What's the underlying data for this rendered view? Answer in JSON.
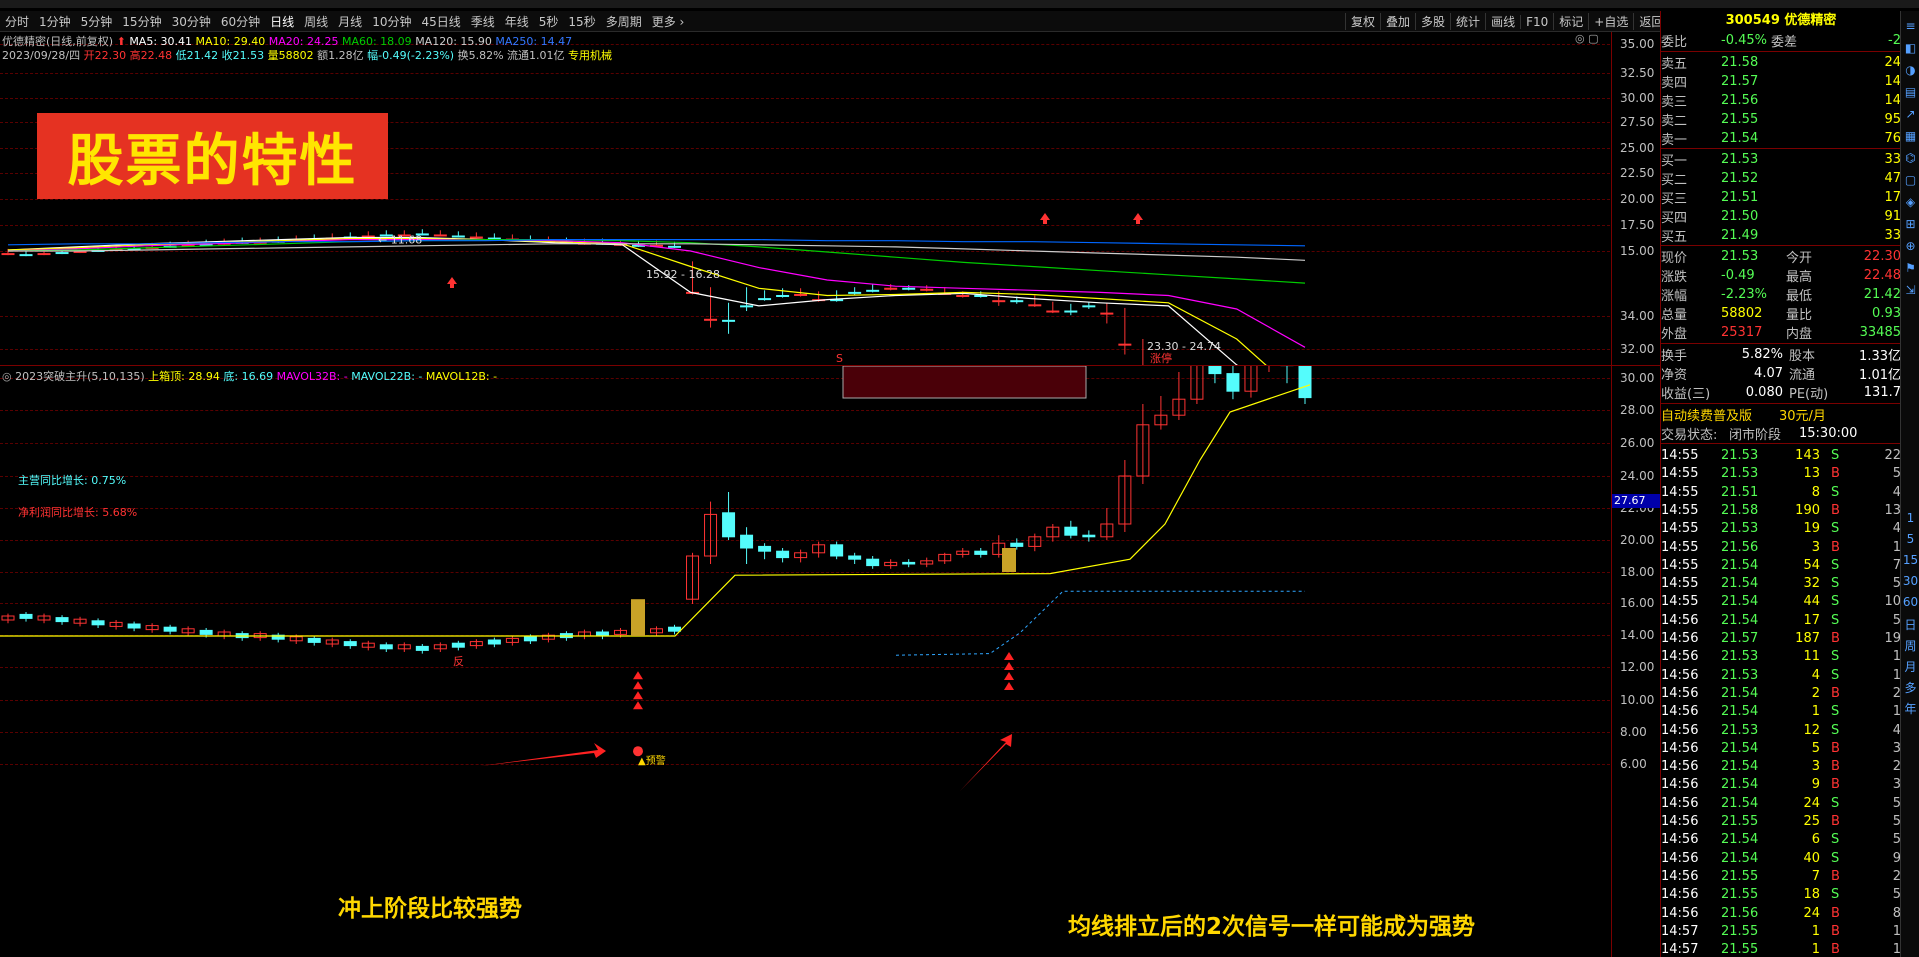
{
  "period_tabs": [
    "分时",
    "1分钟",
    "5分钟",
    "15分钟",
    "30分钟",
    "60分钟",
    "日线",
    "周线",
    "月线",
    "10分钟",
    "45日线",
    "季线",
    "年线",
    "5秒",
    "15秒",
    "多周期",
    "更多 ›"
  ],
  "toolbar": [
    "复权",
    "叠加",
    "多股",
    "统计",
    "画线",
    "F10",
    "标记",
    "+自选",
    "返回"
  ],
  "stock_header": "300549 优德精密",
  "main_info": {
    "name": "优德精密(日线,前复权)",
    "ma5": "MA5: 30.41",
    "ma10": "MA10: 29.40",
    "ma20": "MA20: 24.25",
    "ma60": "MA60: 18.09",
    "ma120": "MA120: 15.90",
    "ma250": "MA250: 14.47",
    "date": "2023/09/28/四",
    "open": "开22.30",
    "high": "高22.48",
    "low": "低21.42",
    "close": "收21.53",
    "vol": "量58802",
    "amount": "额1.28亿",
    "chg": "幅-0.49(-2.23%)",
    "turnover": "换5.82%",
    "float": "流通1.01亿",
    "sector": "专用机械"
  },
  "sub_info": {
    "name": "2023突破主升(5,10,135)",
    "upper": "上箱顶: 28.94",
    "bottom": "底: 16.69",
    "m32": "MAVOL32B: -",
    "m22": "MAVOL22B: -",
    "m12": "MAVOL12B: -"
  },
  "overlay_title": "股票的特性",
  "annotations": {
    "left": "冲上阶段比较强势",
    "right": "均线排立后的2次信号一样可能成为强势",
    "main_growth": "主营同比增长: 0.75%",
    "profit_growth": "净利润同比增长: 5.68%",
    "high_label": "34.00",
    "low_label": "11.68",
    "range1": "15.92 - 16.28",
    "range2": "23.30 - 24.74",
    "zhangting": "涨停",
    "alert": "▲预警",
    "s_marker": "S",
    "fan": "反",
    "price_tag": "27.67"
  },
  "y_main": [
    "35.00",
    "32.50",
    "30.00",
    "27.50",
    "25.00",
    "22.50",
    "20.00",
    "17.50",
    "15.00"
  ],
  "y_sub": [
    "34.00",
    "32.00",
    "30.00",
    "28.00",
    "26.00",
    "24.00",
    "22.00",
    "20.00",
    "18.00",
    "16.00",
    "14.00",
    "12.00",
    "10.00",
    "8.00",
    "6.00"
  ],
  "quote": {
    "weibi": {
      "label": "委比",
      "pct": "-0.45%",
      "label2": "委差",
      "val": "-2"
    },
    "sells": [
      {
        "l": "卖五",
        "p": "21.58",
        "v": "24"
      },
      {
        "l": "卖四",
        "p": "21.57",
        "v": "14"
      },
      {
        "l": "卖三",
        "p": "21.56",
        "v": "14"
      },
      {
        "l": "卖二",
        "p": "21.55",
        "v": "95"
      },
      {
        "l": "卖一",
        "p": "21.54",
        "v": "76"
      }
    ],
    "buys": [
      {
        "l": "买一",
        "p": "21.53",
        "v": "33"
      },
      {
        "l": "买二",
        "p": "21.52",
        "v": "47"
      },
      {
        "l": "买三",
        "p": "21.51",
        "v": "17"
      },
      {
        "l": "买四",
        "p": "21.50",
        "v": "91"
      },
      {
        "l": "买五",
        "p": "21.49",
        "v": "33"
      }
    ],
    "stats": [
      {
        "l1": "现价",
        "v1": "21.53",
        "l2": "今开",
        "v2": "22.30"
      },
      {
        "l1": "涨跌",
        "v1": "-0.49",
        "l2": "最高",
        "v2": "22.48"
      },
      {
        "l1": "涨幅",
        "v1": "-2.23%",
        "l2": "最低",
        "v2": "21.42"
      },
      {
        "l1": "总量",
        "v1": "58802",
        "l2": "量比",
        "v2": "0.93"
      },
      {
        "l1": "外盘",
        "v1": "25317",
        "l2": "内盘",
        "v2": "33485"
      }
    ],
    "stats2": [
      {
        "l1": "换手",
        "v1": "5.82%",
        "l2": "股本",
        "v2": "1.33亿"
      },
      {
        "l1": "净资",
        "v1": "4.07",
        "l2": "流通",
        "v2": "1.01亿"
      },
      {
        "l1": "收益(三)",
        "v1": "0.080",
        "l2": "PE(动)",
        "v2": "131.7"
      }
    ],
    "promo": "自动续费普及版",
    "promo_price": "30元/月",
    "status_label": "交易状态:",
    "status_val": "闭市阶段",
    "status_time": "15:30:00",
    "ticks": [
      [
        "14:55",
        "21.53",
        "143",
        "S",
        "22"
      ],
      [
        "14:55",
        "21.53",
        "13",
        "B",
        "5"
      ],
      [
        "14:55",
        "21.51",
        "8",
        "S",
        "4"
      ],
      [
        "14:55",
        "21.58",
        "190",
        "B",
        "13"
      ],
      [
        "14:55",
        "21.53",
        "19",
        "S",
        "4"
      ],
      [
        "14:55",
        "21.56",
        "3",
        "B",
        "1"
      ],
      [
        "14:55",
        "21.54",
        "54",
        "S",
        "7"
      ],
      [
        "14:55",
        "21.54",
        "32",
        "S",
        "5"
      ],
      [
        "14:55",
        "21.54",
        "44",
        "S",
        "10"
      ],
      [
        "14:56",
        "21.54",
        "17",
        "S",
        "5"
      ],
      [
        "14:56",
        "21.57",
        "187",
        "B",
        "19"
      ],
      [
        "14:56",
        "21.53",
        "11",
        "S",
        "1"
      ],
      [
        "14:56",
        "21.53",
        "4",
        "S",
        "1"
      ],
      [
        "14:56",
        "21.54",
        "2",
        "B",
        "2"
      ],
      [
        "14:56",
        "21.54",
        "1",
        "S",
        "1"
      ],
      [
        "14:56",
        "21.53",
        "12",
        "S",
        "4"
      ],
      [
        "14:56",
        "21.54",
        "5",
        "B",
        "3"
      ],
      [
        "14:56",
        "21.54",
        "3",
        "B",
        "2"
      ],
      [
        "14:56",
        "21.54",
        "9",
        "B",
        "3"
      ],
      [
        "14:56",
        "21.54",
        "24",
        "S",
        "5"
      ],
      [
        "14:56",
        "21.55",
        "25",
        "B",
        "5"
      ],
      [
        "14:56",
        "21.54",
        "6",
        "S",
        "5"
      ],
      [
        "14:56",
        "21.54",
        "40",
        "S",
        "9"
      ],
      [
        "14:56",
        "21.55",
        "7",
        "B",
        "2"
      ],
      [
        "14:56",
        "21.55",
        "18",
        "S",
        "5"
      ],
      [
        "14:56",
        "21.56",
        "24",
        "B",
        "8"
      ],
      [
        "14:57",
        "21.55",
        "1",
        "B",
        "1"
      ],
      [
        "14:57",
        "21.55",
        "1",
        "B",
        "1"
      ]
    ]
  },
  "sidebar_right": [
    "1",
    "5",
    "15",
    "30",
    "60",
    "日",
    "周",
    "月",
    "多",
    "年"
  ],
  "colors": {
    "up": "#ff3333",
    "down": "#54fcfc",
    "ma5": "#ffffff",
    "ma10": "#ffff00",
    "ma20": "#ff00ff",
    "ma60": "#00cc00",
    "ma120": "#cccccc",
    "ma250": "#0066ff",
    "grid": "#5a0000"
  }
}
